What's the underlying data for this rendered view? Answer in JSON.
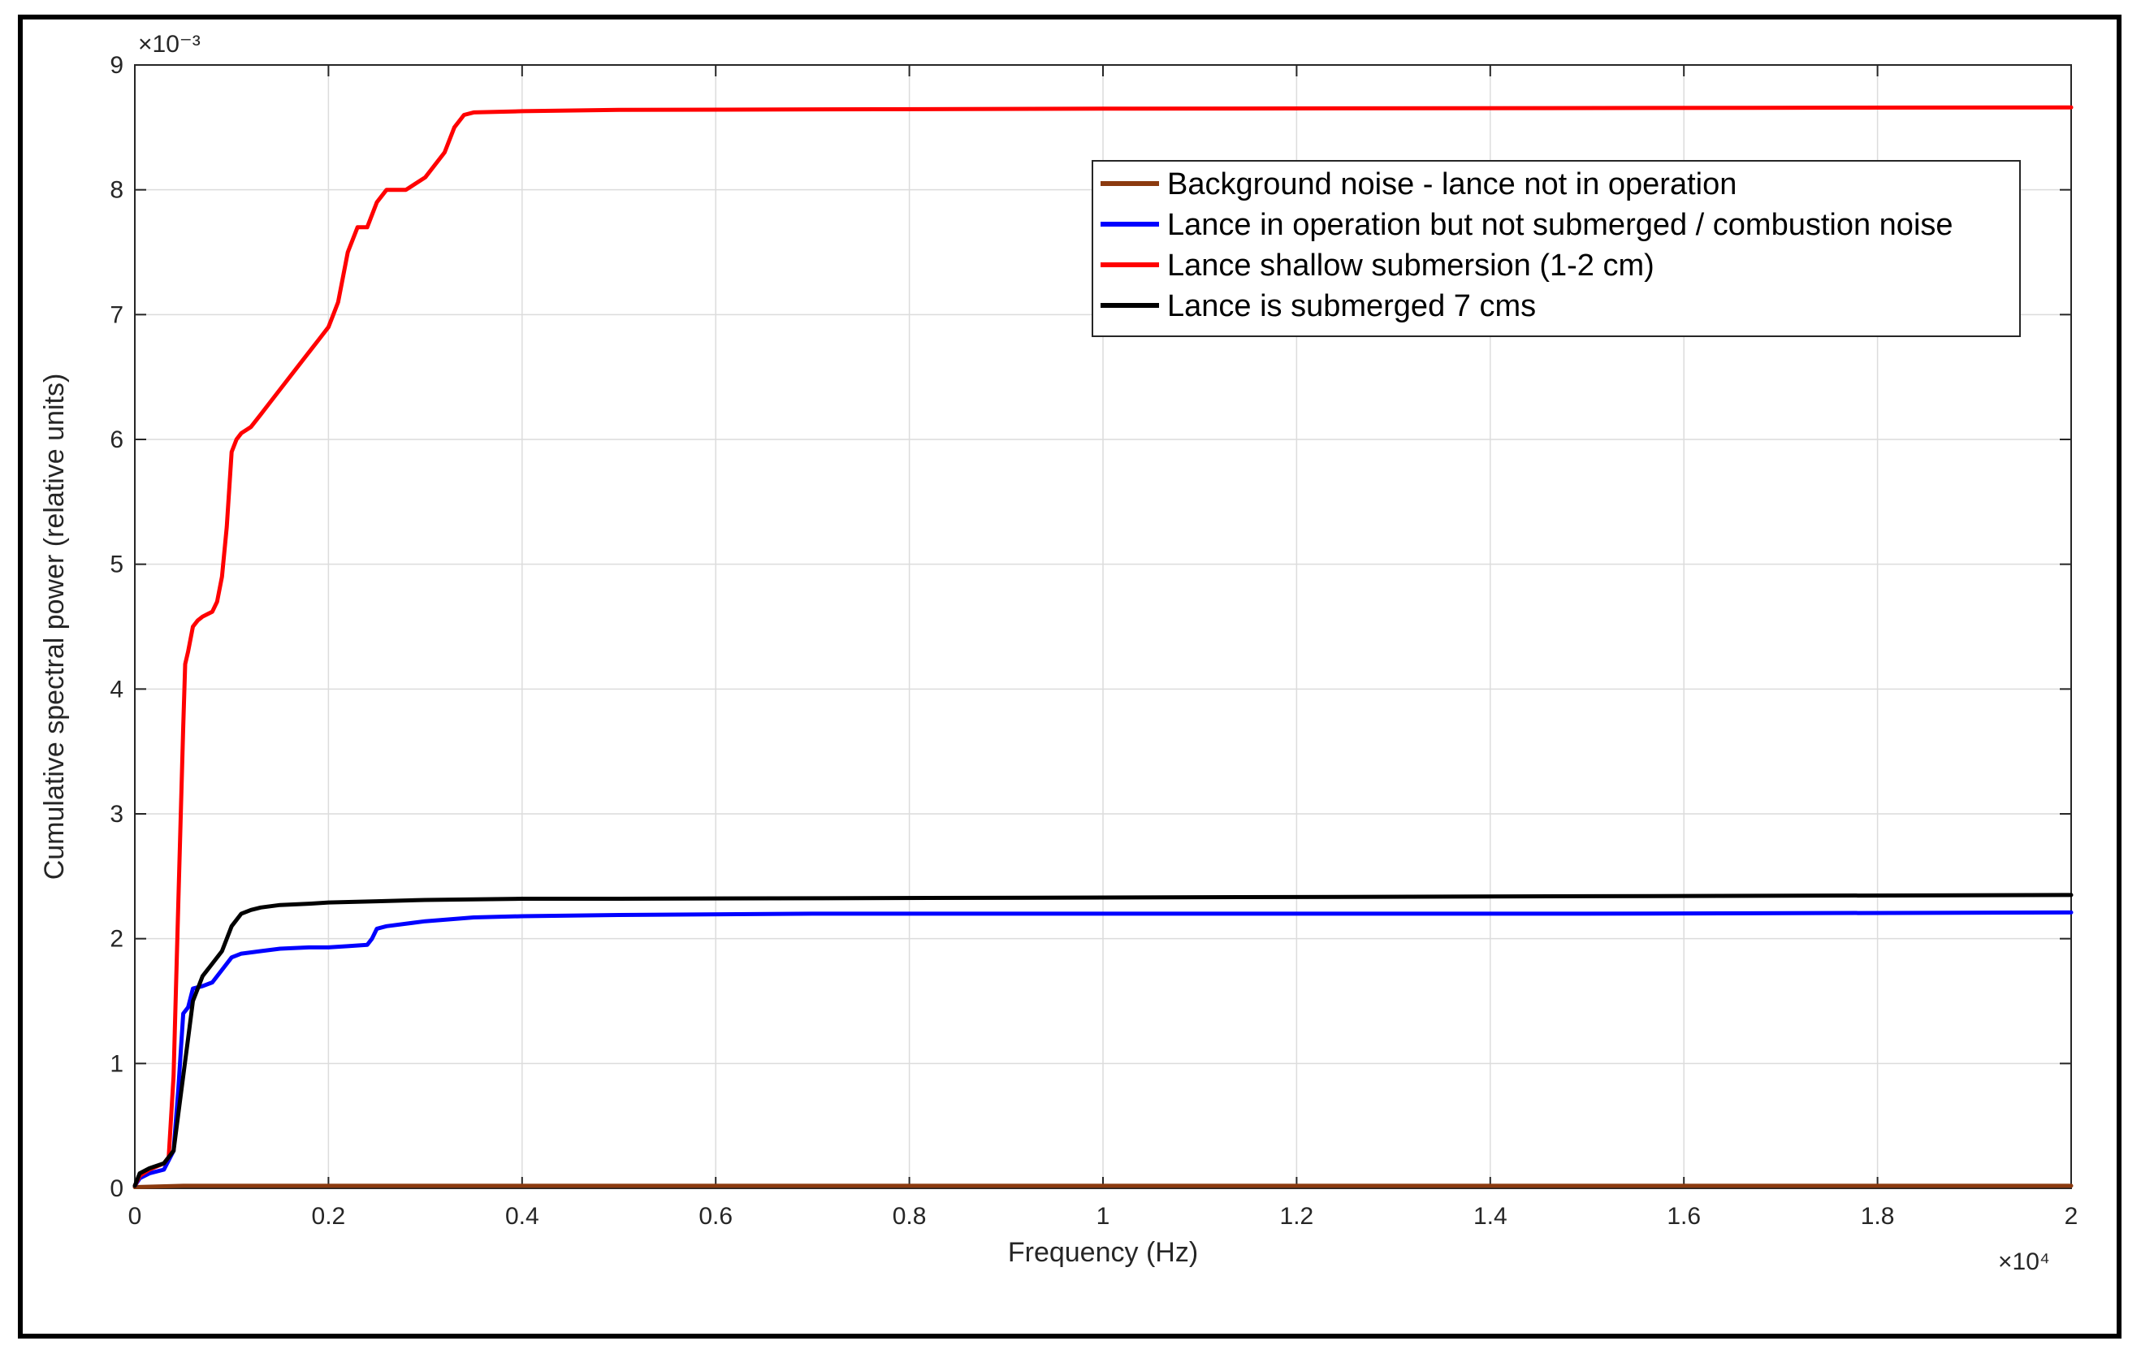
{
  "chart_data": {
    "type": "line",
    "title": "",
    "xlabel": "Frequency (Hz)",
    "ylabel": "Cumulative spectral power (relative units)",
    "x_multiplier": "×10⁴",
    "y_multiplier": "×10⁻³",
    "xlim": [
      0,
      20000
    ],
    "ylim": [
      0,
      0.009
    ],
    "x_ticks": [
      0,
      2000,
      4000,
      6000,
      8000,
      10000,
      12000,
      14000,
      16000,
      18000,
      20000
    ],
    "x_tick_labels": [
      "0",
      "0.2",
      "0.4",
      "0.6",
      "0.8",
      "1",
      "1.2",
      "1.4",
      "1.6",
      "1.8",
      "2"
    ],
    "y_ticks": [
      0,
      0.001,
      0.002,
      0.003,
      0.004,
      0.005,
      0.006,
      0.007,
      0.008,
      0.009
    ],
    "y_tick_labels": [
      "0",
      "1",
      "2",
      "3",
      "4",
      "5",
      "6",
      "7",
      "8",
      "9"
    ],
    "grid": true,
    "legend_position": "top-right",
    "series": [
      {
        "name": "Background noise - lance not in operation",
        "color": "#8B3A0F",
        "x": [
          0,
          500,
          2000,
          5000,
          10000,
          15000,
          20000
        ],
        "y": [
          1e-05,
          2e-05,
          2e-05,
          2e-05,
          2e-05,
          2e-05,
          2e-05
        ]
      },
      {
        "name": "Lance in operation but not submerged / combustion noise",
        "color": "#0000FF",
        "x": [
          0,
          50,
          150,
          300,
          400,
          450,
          500,
          550,
          600,
          700,
          800,
          900,
          1000,
          1100,
          1300,
          1500,
          1800,
          2000,
          2200,
          2400,
          2450,
          2500,
          2600,
          3000,
          3500,
          4000,
          5000,
          7000,
          10000,
          15000,
          20000
        ],
        "y": [
          2e-05,
          8e-05,
          0.00012,
          0.00015,
          0.0003,
          0.0008,
          0.0014,
          0.00145,
          0.0016,
          0.00162,
          0.00165,
          0.00175,
          0.00185,
          0.00188,
          0.0019,
          0.00192,
          0.00193,
          0.00193,
          0.00194,
          0.00195,
          0.002,
          0.00208,
          0.0021,
          0.00214,
          0.00217,
          0.00218,
          0.00219,
          0.0022,
          0.0022,
          0.0022,
          0.00221
        ],
        "line_width": 3
      },
      {
        "name": "Lance shallow submersion (1-2 cm)",
        "color": "#FF0000",
        "x": [
          0,
          50,
          150,
          300,
          350,
          400,
          450,
          500,
          520,
          550,
          600,
          650,
          700,
          800,
          850,
          900,
          950,
          1000,
          1050,
          1100,
          1200,
          1300,
          1400,
          1500,
          1700,
          1900,
          2000,
          2050,
          2100,
          2200,
          2300,
          2400,
          2500,
          2600,
          2800,
          3000,
          3200,
          3300,
          3400,
          3500,
          4000,
          5000,
          10000,
          20000
        ],
        "y": [
          2e-05,
          0.0001,
          0.00015,
          0.0002,
          0.00025,
          0.0009,
          0.0023,
          0.0037,
          0.0042,
          0.0043,
          0.0045,
          0.00455,
          0.00458,
          0.00462,
          0.0047,
          0.0049,
          0.0053,
          0.0059,
          0.006,
          0.00605,
          0.0061,
          0.0062,
          0.0063,
          0.0064,
          0.0066,
          0.0068,
          0.0069,
          0.007,
          0.0071,
          0.0075,
          0.0077,
          0.0077,
          0.0079,
          0.008,
          0.008,
          0.0081,
          0.0083,
          0.0085,
          0.0086,
          0.00862,
          0.00863,
          0.00864,
          0.00865,
          0.00866
        ],
        "line_width": 3
      },
      {
        "name": "Lance is submerged 7 cms",
        "color": "#000000",
        "x": [
          0,
          50,
          150,
          300,
          400,
          450,
          500,
          550,
          600,
          650,
          700,
          800,
          900,
          1000,
          1100,
          1200,
          1300,
          1500,
          1800,
          2000,
          2500,
          3000,
          4000,
          5000,
          10000,
          15000,
          20000
        ],
        "y": [
          2e-05,
          0.00012,
          0.00016,
          0.0002,
          0.0003,
          0.0006,
          0.0009,
          0.0012,
          0.0015,
          0.0016,
          0.0017,
          0.0018,
          0.0019,
          0.0021,
          0.0022,
          0.00223,
          0.00225,
          0.00227,
          0.00228,
          0.00229,
          0.0023,
          0.00231,
          0.00232,
          0.00232,
          0.00233,
          0.00234,
          0.00235
        ],
        "line_width": 3
      }
    ]
  }
}
